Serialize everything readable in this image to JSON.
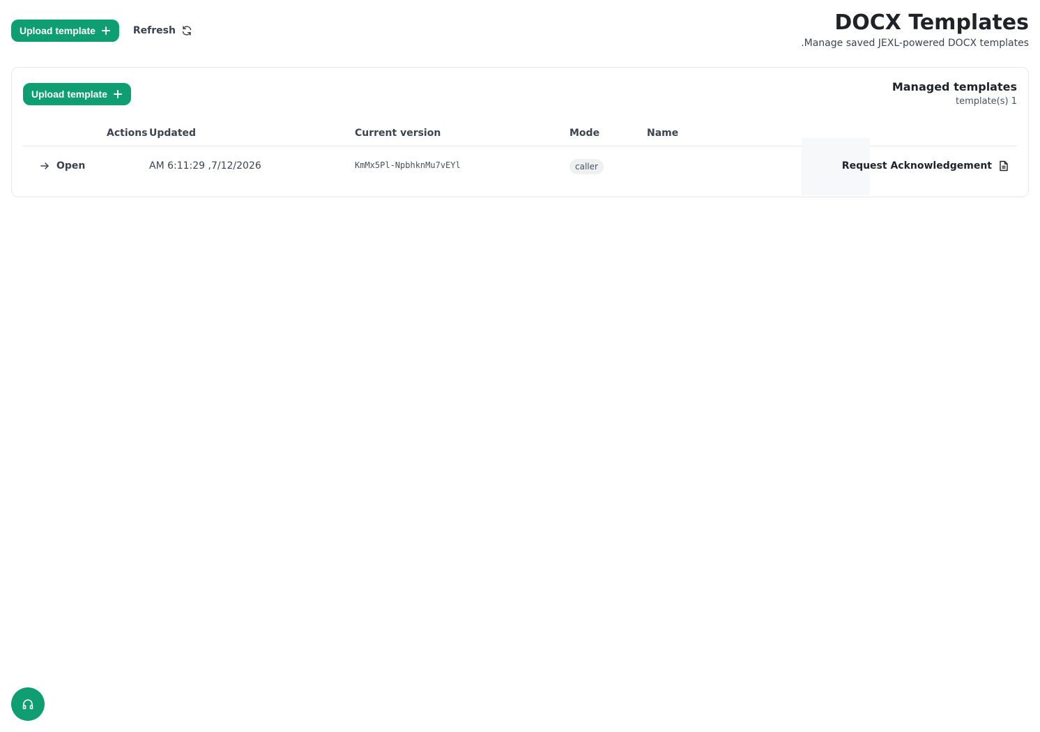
{
  "header": {
    "upload_label": "Upload template",
    "refresh_label": "Refresh",
    "title": "DOCX Templates",
    "subtitle": ".Manage saved JEXL-powered DOCX templates"
  },
  "card": {
    "upload_label": "Upload template",
    "title": "Managed templates",
    "count": "template(s) 1"
  },
  "table": {
    "columns": {
      "actions": "Actions",
      "updated": "Updated",
      "version": "Current version",
      "mode": "Mode",
      "name": "Name"
    },
    "rows": [
      {
        "action": "Open",
        "updated": "AM 6:11:29 ,7/12/2026",
        "version": "KmMx5Pl-NpbhknMu7vEYl",
        "mode": "caller",
        "name": "Request Acknowledgement"
      }
    ]
  },
  "icons": {
    "upload": "plus-icon",
    "refresh": "refresh-icon",
    "open": "arrow-right-icon",
    "name": "document-icon",
    "help": "headphones-icon"
  },
  "colors": {
    "accent": "#0e9e72",
    "text": "#1f2328",
    "muted": "#3d4450",
    "border": "#e6e8eb"
  }
}
